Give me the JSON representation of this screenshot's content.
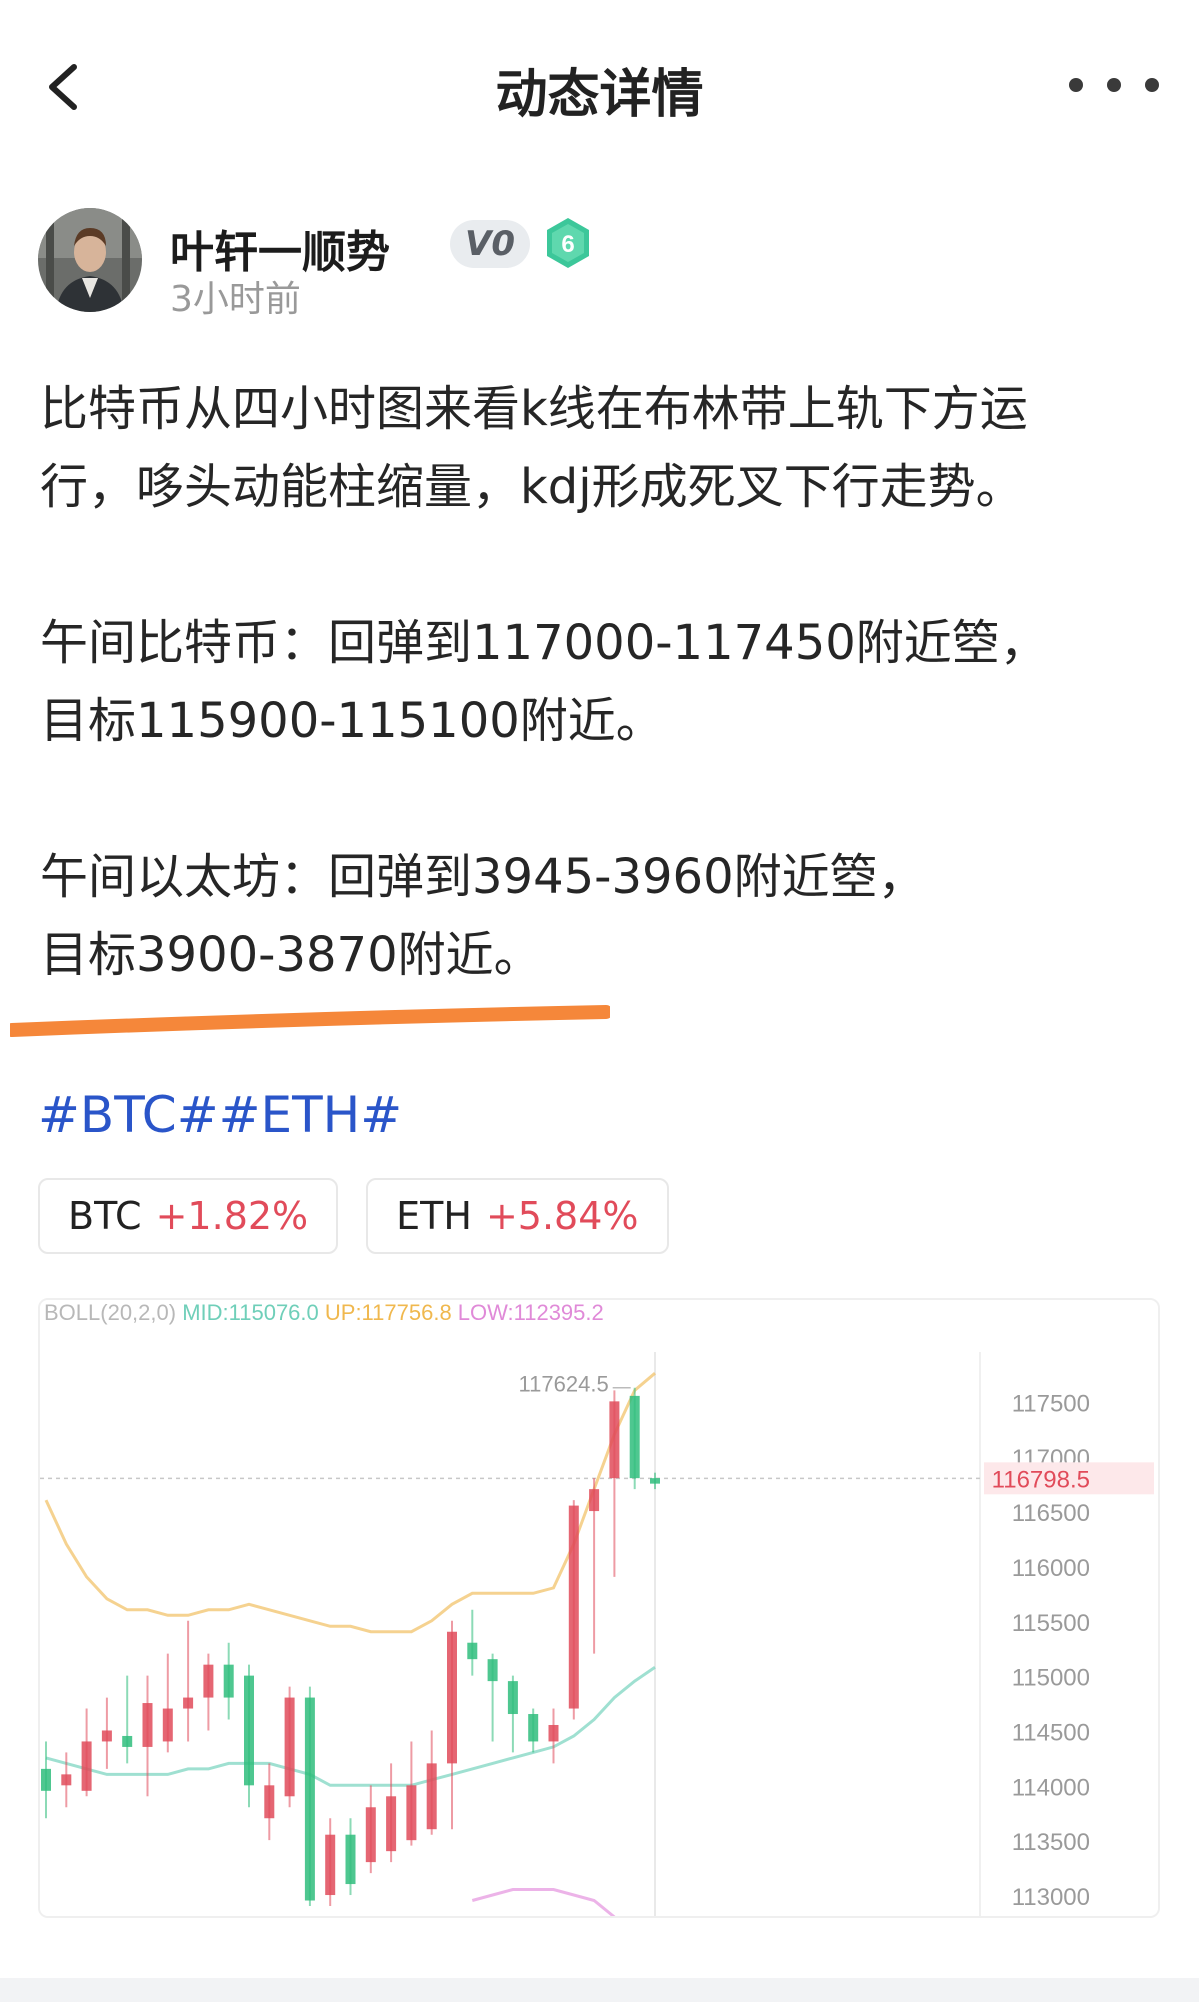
{
  "header": {
    "title": "动态详情",
    "back_icon": "chevron-left-icon",
    "more_icon": "more-horizontal-icon"
  },
  "author": {
    "name": "叶轩一顺势",
    "vip_badge": "V0",
    "level": "6",
    "posted_time": "3小时前"
  },
  "post": {
    "paragraphs": [
      [
        "比特币从四小时图来看k线在布林带上轨下方运",
        "行，哆头动能柱缩量，kdj形成死叉下行走势。"
      ],
      [
        "午间比特币：回弹到117000-117450附近箜，",
        "目标115900-115100附近。"
      ],
      [
        "午间以太坊：回弹到3945-3960附近箜，",
        "目标3900-3870附近。"
      ]
    ],
    "hashtags": "#BTC##ETH#",
    "coins": [
      {
        "symbol": "BTC",
        "change": "+1.82%"
      },
      {
        "symbol": "ETH",
        "change": "+5.84%"
      }
    ]
  },
  "colors": {
    "accent_link": "#2a55c9",
    "up_red": "#e14b5a",
    "down_green": "#2fbd7c",
    "highlight_orange": "#f5873a",
    "level_badge": "#3cc79a"
  },
  "chart_data": {
    "type": "candlestick",
    "indicator_label": "BOLL(20,2,0)",
    "mid_label": "MID:115076.0",
    "up_label": "UP:117756.8",
    "low_label": "LOW:112395.2",
    "high_marker": "117624.5",
    "current_price": "116798.5",
    "ylim": [
      112900,
      117950
    ],
    "yticks": [
      "117500",
      "117000",
      "116500",
      "116000",
      "115500",
      "115000",
      "114500",
      "114000",
      "113500",
      "113000"
    ],
    "candles": [
      {
        "o": 114150,
        "c": 113950,
        "h": 114400,
        "l": 113700
      },
      {
        "o": 114000,
        "c": 114100,
        "h": 114300,
        "l": 113800
      },
      {
        "o": 113950,
        "c": 114400,
        "h": 114700,
        "l": 113900
      },
      {
        "o": 114400,
        "c": 114500,
        "h": 114800,
        "l": 114150
      },
      {
        "o": 114450,
        "c": 114350,
        "h": 115000,
        "l": 114200
      },
      {
        "o": 114350,
        "c": 114750,
        "h": 115000,
        "l": 113900
      },
      {
        "o": 114400,
        "c": 114700,
        "h": 115200,
        "l": 114300
      },
      {
        "o": 114700,
        "c": 114800,
        "h": 115500,
        "l": 114400
      },
      {
        "o": 114800,
        "c": 115100,
        "h": 115200,
        "l": 114500
      },
      {
        "o": 115100,
        "c": 114800,
        "h": 115300,
        "l": 114600
      },
      {
        "o": 115000,
        "c": 114000,
        "h": 115100,
        "l": 113800
      },
      {
        "o": 113700,
        "c": 114000,
        "h": 114200,
        "l": 113500
      },
      {
        "o": 113900,
        "c": 114800,
        "h": 114900,
        "l": 113800
      },
      {
        "o": 114800,
        "c": 112950,
        "h": 114900,
        "l": 112900
      },
      {
        "o": 113000,
        "c": 113550,
        "h": 113700,
        "l": 112900
      },
      {
        "o": 113550,
        "c": 113100,
        "h": 113700,
        "l": 113000
      },
      {
        "o": 113300,
        "c": 113800,
        "h": 114000,
        "l": 113200
      },
      {
        "o": 113400,
        "c": 113900,
        "h": 114200,
        "l": 113300
      },
      {
        "o": 113500,
        "c": 114000,
        "h": 114400,
        "l": 113450
      },
      {
        "o": 113600,
        "c": 114200,
        "h": 114500,
        "l": 113550
      },
      {
        "o": 114200,
        "c": 115400,
        "h": 115500,
        "l": 113600
      },
      {
        "o": 115300,
        "c": 115150,
        "h": 115600,
        "l": 115000
      },
      {
        "o": 115150,
        "c": 114950,
        "h": 115200,
        "l": 114400
      },
      {
        "o": 114950,
        "c": 114650,
        "h": 115000,
        "l": 114300
      },
      {
        "o": 114650,
        "c": 114400,
        "h": 114700,
        "l": 114300
      },
      {
        "o": 114400,
        "c": 114550,
        "h": 114700,
        "l": 114200
      },
      {
        "o": 114700,
        "c": 116550,
        "h": 116600,
        "l": 114600
      },
      {
        "o": 116500,
        "c": 116700,
        "h": 116800,
        "l": 115200
      },
      {
        "o": 116800,
        "c": 117500,
        "h": 117600,
        "l": 115900
      },
      {
        "o": 117550,
        "c": 116800,
        "h": 117624.5,
        "l": 116700
      },
      {
        "o": 116800,
        "c": 116750,
        "h": 116850,
        "l": 116700
      }
    ],
    "upper_band": [
      116600,
      116200,
      115900,
      115700,
      115600,
      115600,
      115550,
      115550,
      115600,
      115600,
      115650,
      115600,
      115550,
      115500,
      115450,
      115450,
      115400,
      115400,
      115400,
      115500,
      115650,
      115750,
      115750,
      115750,
      115750,
      115800,
      116200,
      116700,
      117200,
      117600,
      117756.8
    ],
    "mid_band": [
      114250,
      114200,
      114150,
      114100,
      114100,
      114100,
      114100,
      114150,
      114150,
      114200,
      114200,
      114200,
      114150,
      114100,
      114000,
      114000,
      114000,
      114000,
      114000,
      114050,
      114100,
      114150,
      114200,
      114250,
      114300,
      114350,
      114450,
      114600,
      114800,
      114950,
      115076.0
    ],
    "lower_band": [
      null,
      null,
      null,
      null,
      null,
      null,
      null,
      null,
      null,
      null,
      null,
      null,
      null,
      null,
      null,
      null,
      null,
      null,
      null,
      null,
      null,
      112950,
      113000,
      113050,
      113050,
      113050,
      113000,
      112950,
      112800,
      null,
      null
    ]
  }
}
